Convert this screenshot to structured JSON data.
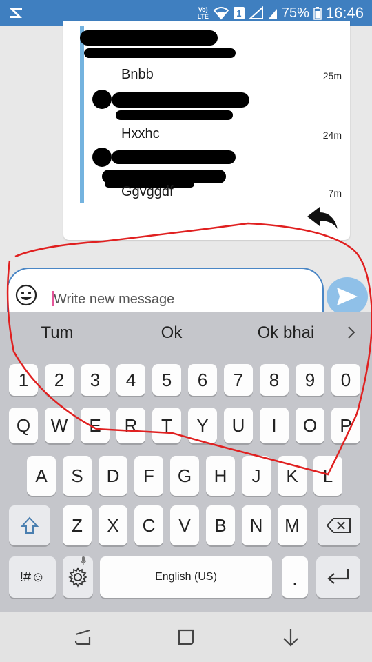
{
  "status_bar": {
    "volte_line1": "Vo)",
    "volte_line2": "LTE",
    "sim_number": "1",
    "battery": "75%",
    "time": "16:46"
  },
  "chat": {
    "messages": [
      {
        "text": "Bnbb",
        "time": "25m"
      },
      {
        "text": "Hxxhc",
        "time": "24m"
      },
      {
        "text": "Ggvggdf",
        "time": "7m"
      }
    ]
  },
  "composer": {
    "placeholder": "Write new message"
  },
  "keyboard": {
    "suggestions": [
      "Tum",
      "Ok",
      "Ok bhai"
    ],
    "number_row": [
      "1",
      "2",
      "3",
      "4",
      "5",
      "6",
      "7",
      "8",
      "9",
      "0"
    ],
    "row1": [
      "Q",
      "W",
      "E",
      "R",
      "T",
      "Y",
      "U",
      "I",
      "O",
      "P"
    ],
    "row2": [
      "A",
      "S",
      "D",
      "F",
      "G",
      "H",
      "J",
      "K",
      "L"
    ],
    "row3": [
      "Z",
      "X",
      "C",
      "V",
      "B",
      "N",
      "M"
    ],
    "symbols_label": "!#☺",
    "space_label": "English (US)",
    "period_label": "."
  },
  "colors": {
    "status_bar": "#3f7fc0",
    "thread_line": "#74b3df",
    "send_button": "#8fc0e8",
    "annotation": "#e02020"
  },
  "icons": {
    "status_left": "notification-app-icon",
    "wifi": "wifi-icon",
    "signal": "signal-icon",
    "battery": "battery-icon",
    "reply": "reply-icon",
    "emoji": "emoji-icon",
    "send": "send-icon",
    "shift": "shift-icon",
    "backspace": "backspace-icon",
    "settings": "settings-icon",
    "enter": "enter-icon",
    "recents": "recents-icon",
    "home": "home-icon",
    "back": "back-icon"
  }
}
